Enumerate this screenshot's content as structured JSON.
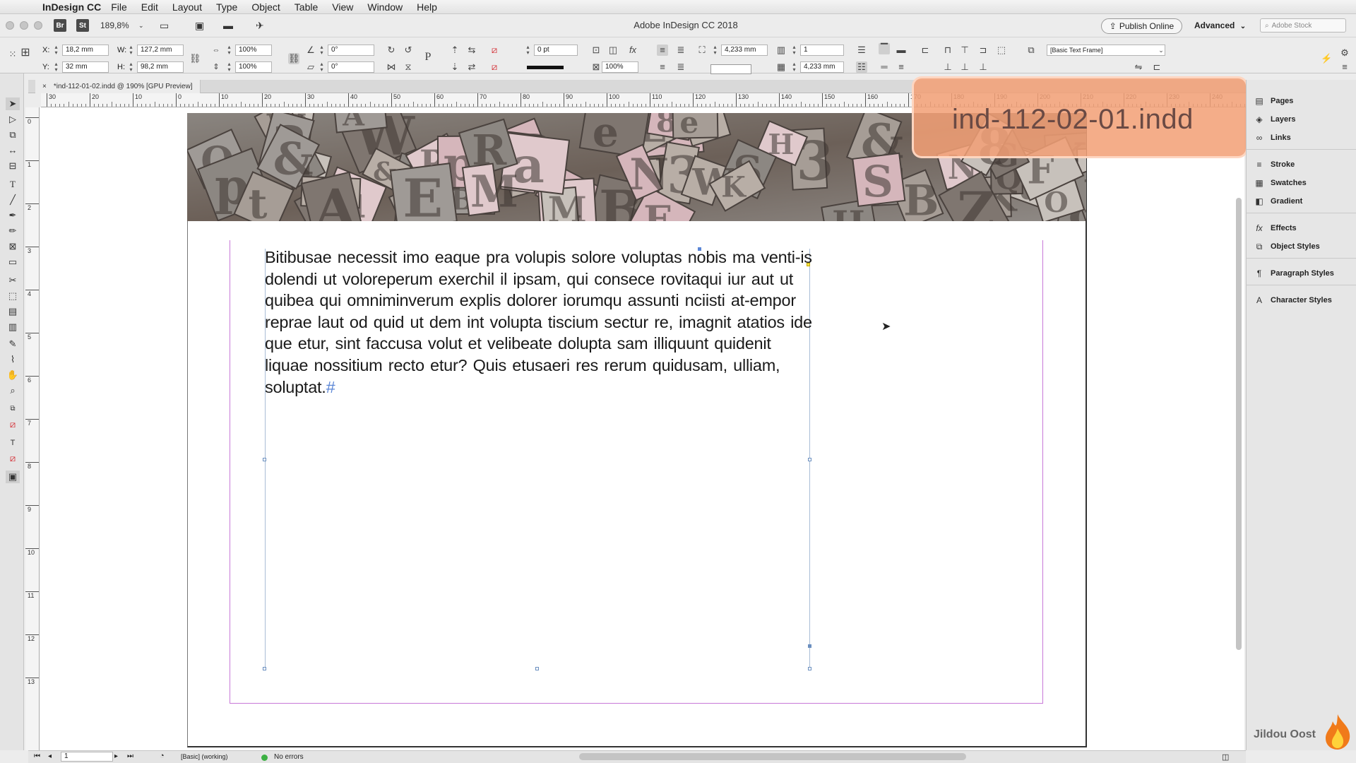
{
  "menubar": {
    "app_name": "InDesign CC",
    "items": [
      "File",
      "Edit",
      "Layout",
      "Type",
      "Object",
      "Table",
      "View",
      "Window",
      "Help"
    ]
  },
  "titlebar": {
    "bridge_label": "Br",
    "stock_label": "St",
    "zoom": "189,8%",
    "title": "Adobe InDesign CC 2018",
    "publish_label": "Publish Online",
    "workspace": "Advanced",
    "search_placeholder": "Adobe Stock"
  },
  "control": {
    "x_label": "X:",
    "x": "18,2 mm",
    "y_label": "Y:",
    "y": "32 mm",
    "w_label": "W:",
    "w": "127,2 mm",
    "h_label": "H:",
    "h": "98,2 mm",
    "scale_x": "100%",
    "scale_y": "100%",
    "rotate": "0°",
    "shear": "0°",
    "stroke_weight": "0 pt",
    "opacity": "100%",
    "offset_top": "4,233 mm",
    "offset_bottom": "4,233 mm",
    "columns": "1",
    "object_style": "[Basic Text Frame]"
  },
  "document_tab": {
    "close": "×",
    "label": "*ind-112-01-02.indd @ 190% [GPU Preview]"
  },
  "rulers": {
    "h_ticks": [
      "30",
      "20",
      "10",
      "0",
      "10",
      "20",
      "30",
      "40",
      "50",
      "60",
      "70",
      "80",
      "90",
      "100",
      "110",
      "120",
      "130",
      "140",
      "150",
      "160",
      "170",
      "180",
      "190",
      "200",
      "210",
      "220",
      "230",
      "240"
    ],
    "v_ticks": [
      "0",
      "1",
      "2",
      "3",
      "4",
      "5",
      "6",
      "7",
      "8",
      "9",
      "10",
      "11",
      "12",
      "13"
    ]
  },
  "document": {
    "body_text": "Bitibusae necessit imo eaque pra volupis solore voluptas nobis ma venti-is dolendi ut voloreperum exerchil il ipsam, qui consece rovitaqui iur aut ut quibea qui omniminverum explis dolorer iorumqu assunti nciisti at-empor reprae laut od quid ut dem int volupta tiscium sectur re, imagnit atatios ide que etur, sint faccusa volut et velibeate dolupta sam illiquunt quidenit liquae nossitium recto etur? Quis etusaeri res rerum quidusam, ulliam, soluptat.",
    "end_mark": "#"
  },
  "overlay_label": "ind-112-02-01.indd",
  "panels": [
    {
      "icon": "pages-icon",
      "label": "Pages"
    },
    {
      "icon": "layers-icon",
      "label": "Layers"
    },
    {
      "icon": "links-icon",
      "label": "Links"
    },
    {
      "icon": "stroke-icon",
      "label": "Stroke"
    },
    {
      "icon": "swatches-icon",
      "label": "Swatches"
    },
    {
      "icon": "gradient-icon",
      "label": "Gradient"
    },
    {
      "icon": "effects-icon",
      "label": "Effects"
    },
    {
      "icon": "object-styles-icon",
      "label": "Object Styles"
    },
    {
      "icon": "paragraph-styles-icon",
      "label": "Paragraph Styles"
    },
    {
      "icon": "character-styles-icon",
      "label": "Character Styles"
    }
  ],
  "statusbar": {
    "page": "1",
    "profile": "[Basic] (working)",
    "preflight": "No errors"
  },
  "watermark": "Jildou Oost",
  "colors": {
    "margin_guide": "#c878d8",
    "frame_edge": "#a9bdd6",
    "preflight_ok": "#3cb043",
    "overlay": "#f2a076"
  }
}
